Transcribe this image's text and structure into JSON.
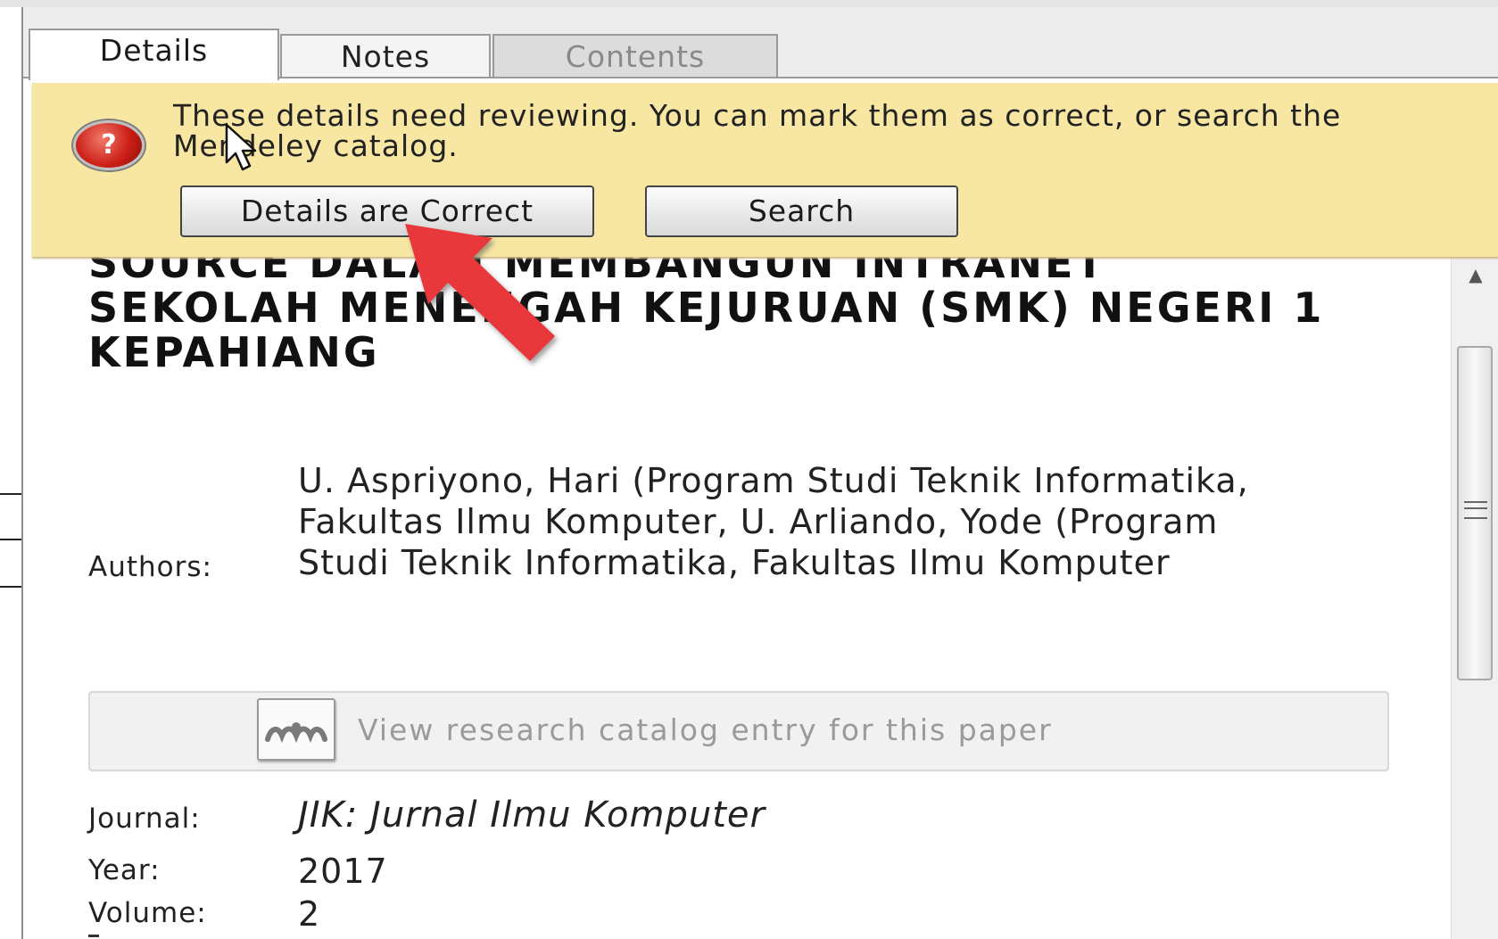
{
  "tabs": [
    {
      "label": "Details",
      "state": "active"
    },
    {
      "label": "Notes",
      "state": "inactive"
    },
    {
      "label": "Contents",
      "state": "disabled"
    }
  ],
  "banner": {
    "icon": "question-warning-icon",
    "message": "These details need reviewing. You can mark them as correct, or search the Mendeley catalog.",
    "correct_button": "Details are Correct",
    "search_button": "Search"
  },
  "document": {
    "title": "SOURCE DALAM MEMBANGUN INTRANET SEKOLAH MENENGAH KEJURUAN (SMK) NEGERI 1 KEPAHIANG",
    "authors_label": "Authors:",
    "authors": "U. Aspriyono, Hari (Program Studi Teknik Informatika, Fakultas Ilmu Komputer, U. Arliando, Yode (Program Studi Teknik Informatika, Fakultas Ilmu Komputer",
    "catalog_link": "View research catalog entry for this paper",
    "journal_label": "Journal:",
    "journal": "JIK: Jurnal Ilmu Komputer",
    "year_label": "Year:",
    "year": "2017",
    "volume_label": "Volume:",
    "volume": "2"
  },
  "colors": {
    "banner_bg": "#f8e7a3",
    "annotation_arrow": "#e8393b"
  }
}
